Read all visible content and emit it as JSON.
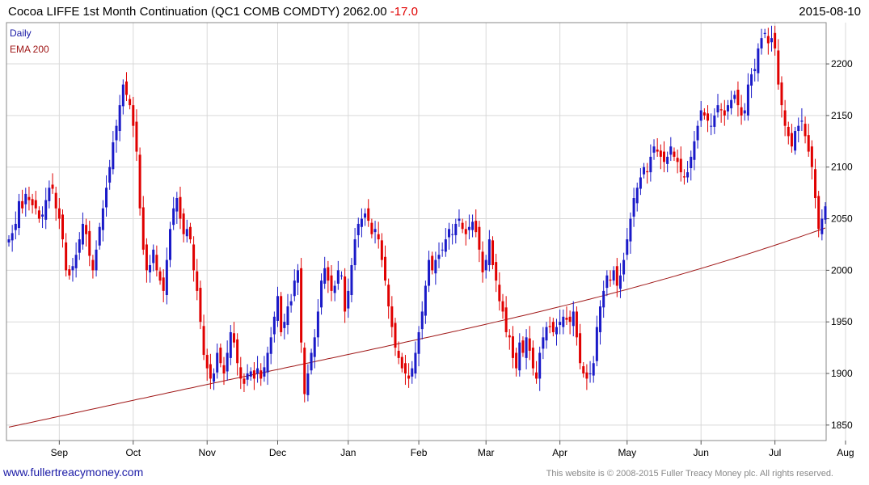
{
  "header": {
    "title": "Cocoa LIFFE 1st Month Continuation (QC1 COMB COMDTY)",
    "last_price": "2062.00",
    "change": "-17.0",
    "date": "2015-08-10"
  },
  "footer": {
    "site": "www.fullertreacymoney.com",
    "copyright": "This website is © 2008-2015 Fuller Treacy Money plc. All rights reserved."
  },
  "colors": {
    "up": "#1a1ac8",
    "down": "#e00000",
    "ema": "#a01818",
    "grid": "#d9d9d9",
    "daily_label": "#1a1aa6",
    "ema_label": "#a01818"
  },
  "chart_data": {
    "type": "candlestick",
    "frequency": "Daily",
    "legend": [
      "Daily",
      "EMA 200"
    ],
    "legend_position": "top-left",
    "y_axis_side": "right",
    "ylim": [
      1835,
      2240
    ],
    "yticks": [
      1850,
      1900,
      1950,
      2000,
      2050,
      2100,
      2150,
      2200
    ],
    "x_months": [
      "Sep",
      "Oct",
      "Nov",
      "Dec",
      "Jan",
      "Feb",
      "Mar",
      "Apr",
      "May",
      "Jun",
      "Jul",
      "Aug"
    ],
    "month_start_index": [
      15,
      37,
      59,
      80,
      101,
      122,
      142,
      164,
      184,
      206,
      228,
      249
    ],
    "grid": true,
    "candles_close": [
      2030,
      2036,
      2045,
      2067,
      2060,
      2074,
      2068,
      2063,
      2060,
      2050,
      2054,
      2068,
      2080,
      2079,
      2060,
      2050,
      2030,
      2000,
      1995,
      2004,
      2015,
      2030,
      2045,
      2035,
      2014,
      2000,
      2020,
      2042,
      2060,
      2080,
      2100,
      2124,
      2140,
      2160,
      2180,
      2170,
      2160,
      2140,
      2115,
      2060,
      2020,
      2000,
      2005,
      2020,
      2000,
      1990,
      1980,
      2010,
      2040,
      2060,
      2070,
      2050,
      2035,
      2040,
      2030,
      2000,
      1980,
      1950,
      1918,
      1905,
      1895,
      1900,
      1920,
      1910,
      1900,
      1920,
      1940,
      1930,
      1910,
      1895,
      1890,
      1900,
      1902,
      1895,
      1905,
      1895,
      1906,
      1920,
      1935,
      1955,
      1975,
      1940,
      1950,
      1965,
      1970,
      1990,
      2000,
      1930,
      1880,
      1900,
      1920,
      1935,
      1960,
      1990,
      2002,
      1990,
      1980,
      1985,
      2000,
      1995,
      1960,
      1980,
      2005,
      2030,
      2045,
      2050,
      2055,
      2048,
      2035,
      2040,
      2030,
      2010,
      1990,
      1965,
      1945,
      1925,
      1915,
      1905,
      1900,
      1895,
      1905,
      1920,
      1940,
      1960,
      1985,
      2010,
      2000,
      2010,
      2015,
      2020,
      2030,
      2040,
      2035,
      2045,
      2050,
      2040,
      2035,
      2042,
      2047,
      2037,
      2020,
      1998,
      2010,
      2030,
      2005,
      1990,
      1970,
      1960,
      1940,
      1935,
      1915,
      1905,
      1930,
      1920,
      1935,
      1922,
      1905,
      1895,
      1920,
      1935,
      1945,
      1945,
      1940,
      1945,
      1950,
      1955,
      1952,
      1950,
      1960,
      1935,
      1910,
      1900,
      1895,
      1900,
      1910,
      1945,
      1965,
      1980,
      1995,
      1990,
      2000,
      1985,
      1995,
      2010,
      2030,
      2050,
      2070,
      2080,
      2090,
      2100,
      2095,
      2110,
      2120,
      2115,
      2110,
      2105,
      2110,
      2120,
      2110,
      2105,
      2095,
      2090,
      2095,
      2110,
      2125,
      2140,
      2155,
      2150,
      2145,
      2140,
      2150,
      2160,
      2155,
      2150,
      2160,
      2165,
      2170,
      2160,
      2150,
      2155,
      2180,
      2190,
      2195,
      2215,
      2225,
      2230,
      2220,
      2225,
      2215,
      2180,
      2160,
      2140,
      2130,
      2120,
      2135,
      2140,
      2145,
      2130,
      2115,
      2100,
      2070,
      2040,
      2050,
      2062
    ],
    "ema_200": {
      "start": 1848,
      "end": 2041
    }
  }
}
